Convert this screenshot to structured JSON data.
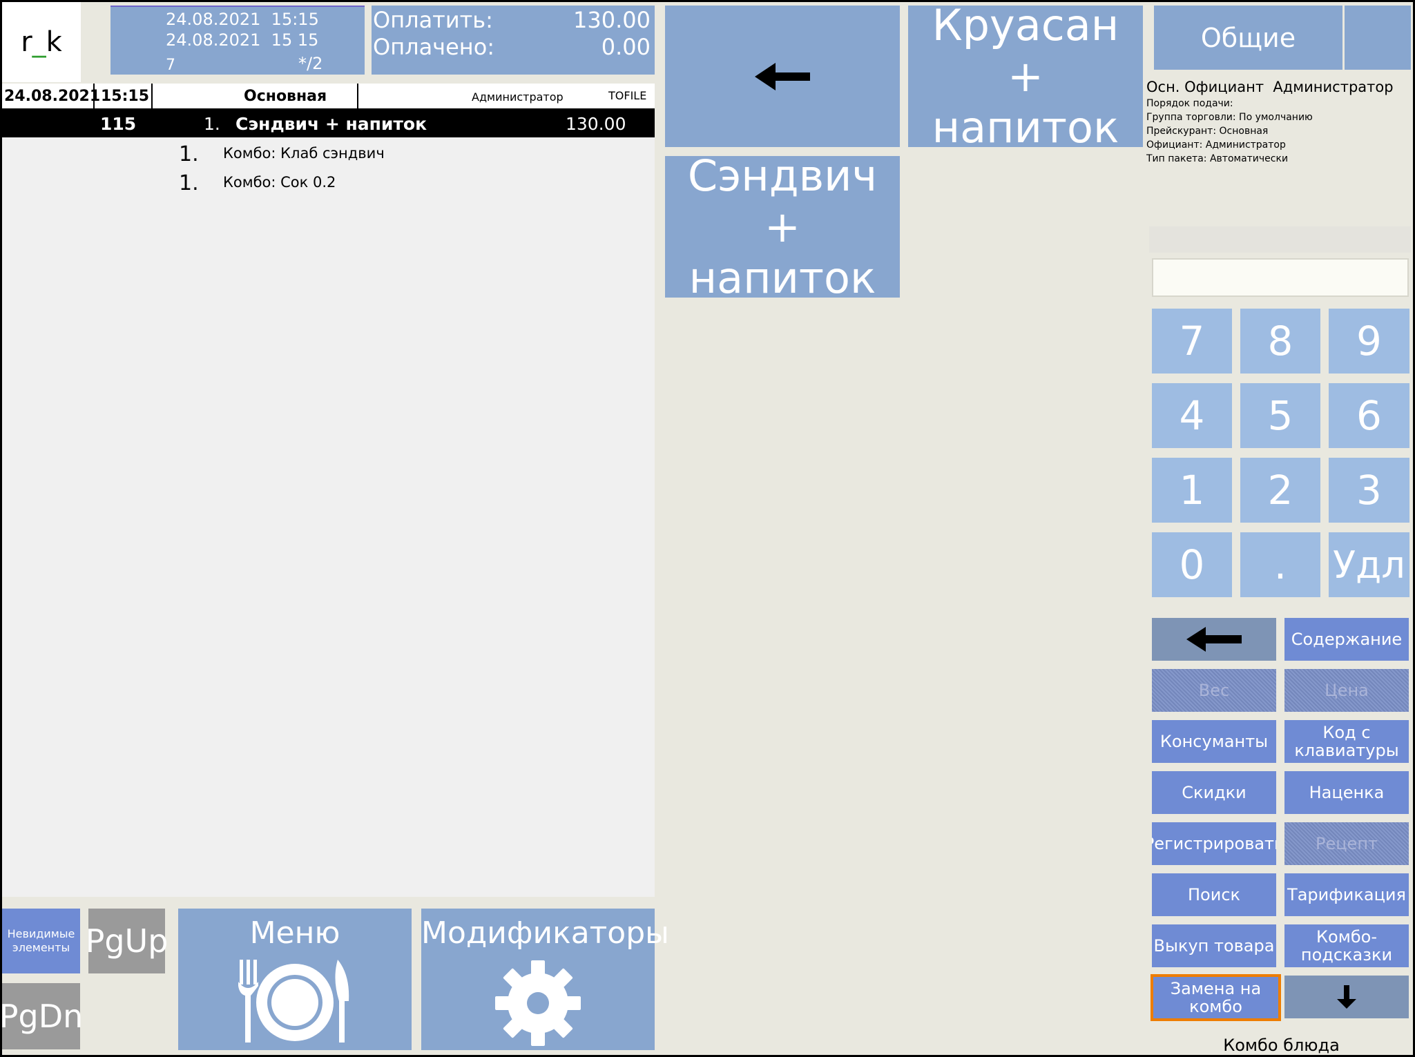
{
  "logo": {
    "text_a": "r",
    "text_underscore": "_",
    "text_b": "k"
  },
  "header": {
    "date1": "24.08.2021  15:15",
    "date2": "24.08.2021  15 15",
    "guests": "7",
    "table_fraction": "*/2",
    "to_pay_label": "Оплатить:",
    "to_pay_value": "130.00",
    "paid_label": "Оплачено:",
    "paid_value": "0.00"
  },
  "check": {
    "date": "24.08.2021",
    "time": "15:15",
    "price_list": "Основная",
    "waiter": "Администратор",
    "file": "TOFILE",
    "dish": {
      "code": "115",
      "qty": "1.",
      "name": "Сэндвич + напиток",
      "price": "130.00"
    },
    "components": [
      {
        "qty": "1.",
        "name": "Комбо: Клаб сэндвич"
      },
      {
        "qty": "1.",
        "name": "Комбо: Сок 0.2"
      }
    ]
  },
  "menu_buttons": {
    "back_icon": "arrow-left-icon",
    "croissant": "Круасан + напиток",
    "sandwich": "Сэндвич + напиток"
  },
  "right": {
    "common_tab": "Общие",
    "info_main": "Осн. Официант  Администратор",
    "info_lines": [
      "Порядок подачи:",
      "Группа торговли: По умолчанию",
      "Прейскурант: Основная",
      "Официант: Администратор",
      "Тип пакета: Автоматически"
    ],
    "keypad": [
      "7",
      "8",
      "9",
      "4",
      "5",
      "6",
      "1",
      "2",
      "3",
      "0",
      ".",
      "Удл"
    ],
    "functions": {
      "content": "Содержание",
      "weight": "Вес",
      "price": "Цена",
      "consumables": "Консуманты",
      "keyboard_code": "Код с клавиатуры",
      "discounts": "Скидки",
      "markup": "Наценка",
      "register": "Регистрировать",
      "recipe": "Рецепт",
      "search": "Поиск",
      "tariff": "Тарификация",
      "buyback": "Выкуп товара",
      "combo_hints": "Комбо-подсказки",
      "replace_combo": "Замена на комбо"
    },
    "footer": "Комбо блюда"
  },
  "bottom": {
    "invisible": "Невидимые элементы",
    "pgup": "PgUp",
    "pgdn": "PgDn",
    "menu": "Меню",
    "modifiers": "Модификаторы"
  },
  "colors": {
    "tile_blue": "#88a6cf",
    "key_blue": "#9ebce2",
    "func_blue": "#6f8bd4",
    "selected_border": "#ee7d00"
  }
}
